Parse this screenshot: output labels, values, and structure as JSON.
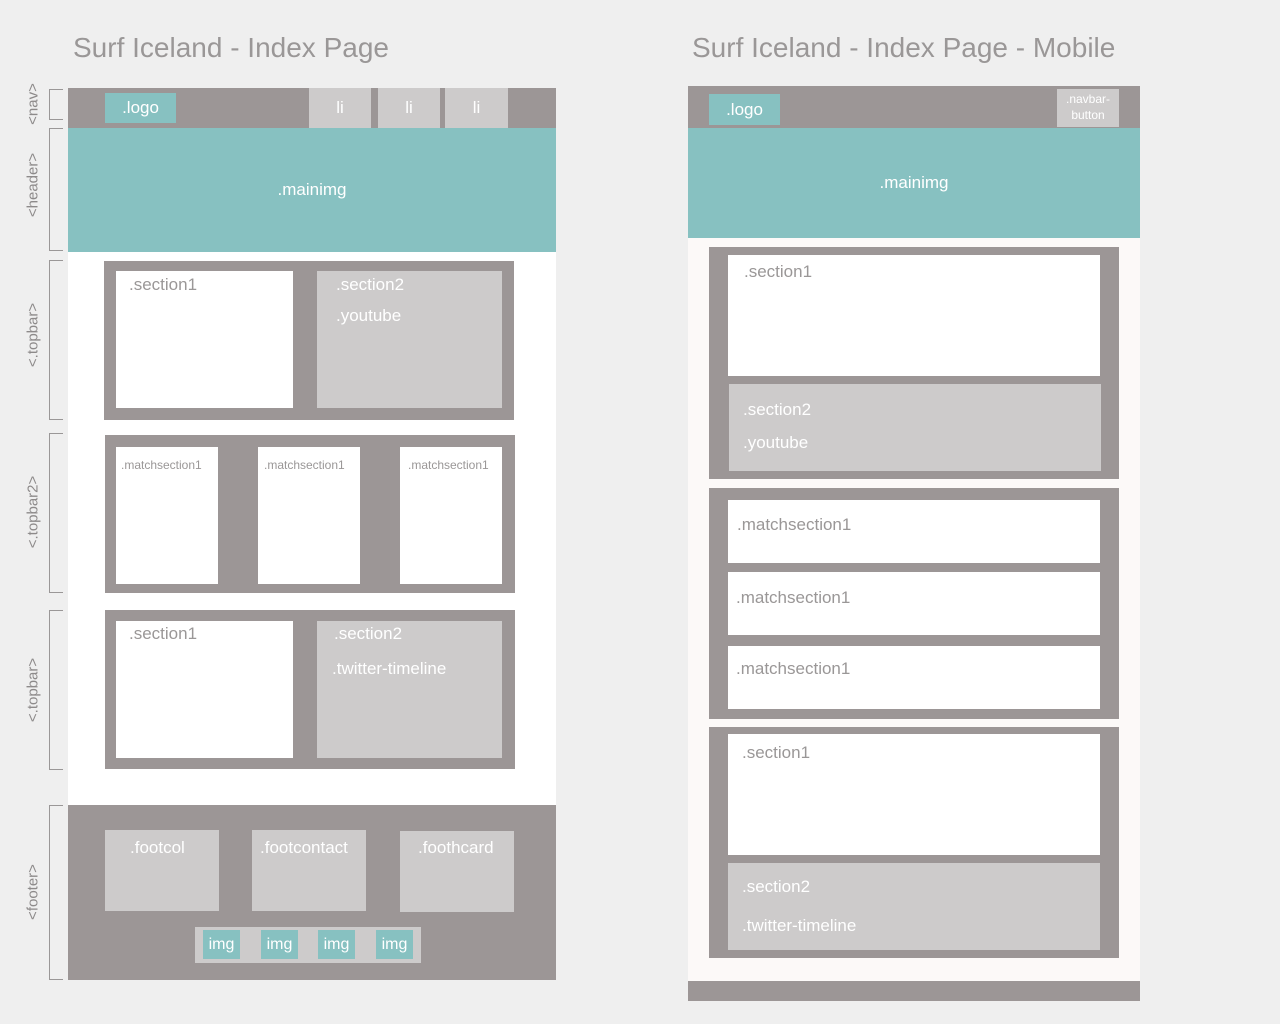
{
  "desktop": {
    "title": "Surf Iceland - Index Page",
    "side_labels": {
      "nav": "<nav>",
      "header": "<header>",
      "topbar": "<.topbar>",
      "topbar2": "<.topbar2>",
      "topbar_b": "<.topbar>",
      "footer": "<footer>"
    },
    "nav": {
      "logo": ".logo",
      "items": [
        "li",
        "li",
        "li"
      ]
    },
    "header": {
      "mainimg": ".mainimg"
    },
    "topbar": {
      "section1": ".section1",
      "section2": ".section2",
      "youtube": ".youtube"
    },
    "topbar2": {
      "matchsections": [
        ".matchsection1",
        ".matchsection1",
        ".matchsection1"
      ]
    },
    "topbar_b": {
      "section1": ".section1",
      "section2": ".section2",
      "twitter": ".twitter-timeline"
    },
    "footer": {
      "footcol": ".footcol",
      "footcontact": ".footcontact",
      "foothcard": ".foothcard",
      "imgs": [
        "img",
        "img",
        "img",
        "img"
      ]
    }
  },
  "mobile": {
    "title": "Surf Iceland - Index Page - Mobile",
    "nav": {
      "logo": ".logo",
      "navbar_button": ".navbar-\nbutton"
    },
    "header": {
      "mainimg": ".mainimg"
    },
    "topbar": {
      "section1": ".section1",
      "section2": ".section2",
      "youtube": ".youtube"
    },
    "topbar2": {
      "matchsections": [
        ".matchsection1",
        ".matchsection1",
        ".matchsection1"
      ]
    },
    "topbar_b": {
      "section1": ".section1",
      "section2": ".section2",
      "twitter": ".twitter-timeline"
    }
  },
  "colors": {
    "background": "#efefef",
    "grey": "#9c9696",
    "light_grey": "#cdcbcb",
    "teal": "#87c1c1",
    "white": "#ffffff"
  }
}
